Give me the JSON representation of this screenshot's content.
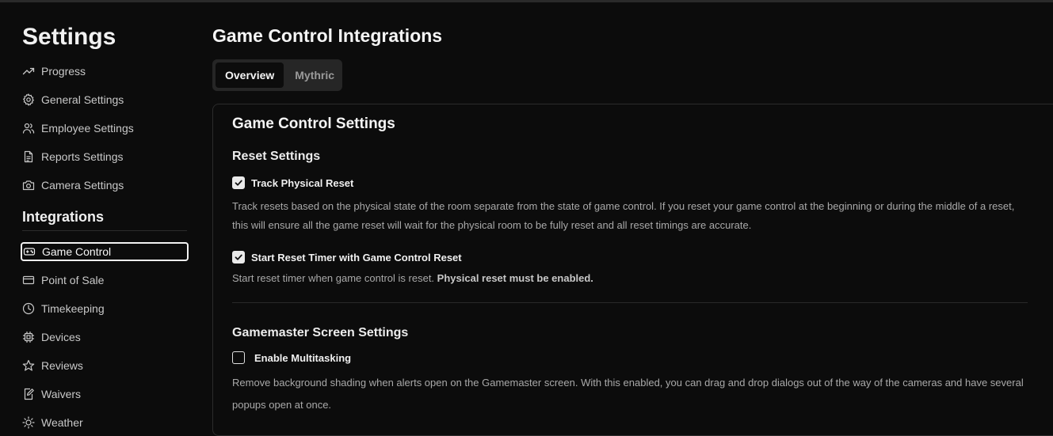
{
  "sidebar": {
    "title": "Settings",
    "items": [
      {
        "label": "Progress",
        "icon": "trending-up-icon"
      },
      {
        "label": "General Settings",
        "icon": "gear-icon"
      },
      {
        "label": "Employee Settings",
        "icon": "users-icon"
      },
      {
        "label": "Reports Settings",
        "icon": "file-text-icon"
      },
      {
        "label": "Camera Settings",
        "icon": "camera-icon"
      }
    ],
    "integrations_heading": "Integrations",
    "integrations": [
      {
        "label": "Game Control",
        "icon": "gamepad-icon",
        "active": true
      },
      {
        "label": "Point of Sale",
        "icon": "credit-card-icon"
      },
      {
        "label": "Timekeeping",
        "icon": "clock-icon"
      },
      {
        "label": "Devices",
        "icon": "chip-icon"
      },
      {
        "label": "Reviews",
        "icon": "star-icon"
      },
      {
        "label": "Waivers",
        "icon": "edit-document-icon"
      },
      {
        "label": "Weather",
        "icon": "sun-icon"
      }
    ]
  },
  "main": {
    "title": "Game Control Integrations",
    "tabs": [
      {
        "label": "Overview",
        "active": true
      },
      {
        "label": "Mythric",
        "active": false
      }
    ],
    "card": {
      "title": "Game Control Settings",
      "reset_section": {
        "title": "Reset Settings",
        "track_physical_reset": {
          "label": "Track Physical Reset",
          "checked": true,
          "description": "Track resets based on the physical state of the room separate from the state of game control. If you reset your game control at the beginning or during the middle of a reset, this will ensure all the game reset will wait for the physical room to be fully reset and all reset timings are accurate."
        },
        "start_reset_timer": {
          "label": "Start Reset Timer with Game Control Reset",
          "checked": true,
          "description": "Start reset timer when game control is reset.",
          "description_bold": "Physical reset must be enabled."
        }
      },
      "gamemaster_section": {
        "title": "Gamemaster Screen Settings",
        "enable_multitasking": {
          "label": "Enable Multitasking",
          "checked": false,
          "description": "Remove background shading when alerts open on the Gamemaster screen. With this enabled, you can drag and drop dialogs out of the way of the cameras and have several popups open at once."
        }
      }
    }
  }
}
